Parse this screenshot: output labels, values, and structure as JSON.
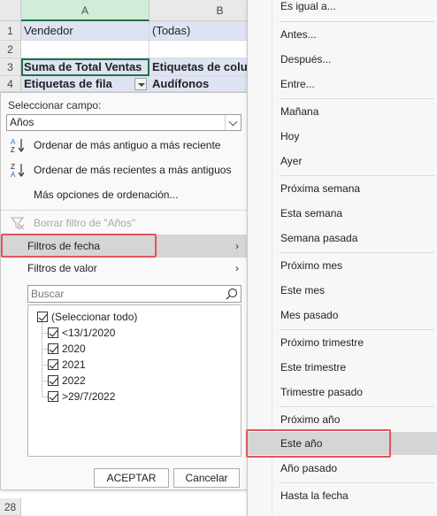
{
  "sheet": {
    "col_a": "A",
    "col_b": "B",
    "rows": [
      {
        "n": "1",
        "a": "Vendedor",
        "b": "(Todas)"
      },
      {
        "n": "2",
        "a": "",
        "b": ""
      },
      {
        "n": "3",
        "a": "Suma de Total Ventas",
        "b": "Etiquetas de colu"
      },
      {
        "n": "4",
        "a": "Etiquetas de fila",
        "b": "Audífonos"
      }
    ],
    "bottom_row": "28"
  },
  "panel": {
    "field_label": "Seleccionar campo:",
    "field_value": "Años",
    "sort_asc": "Ordenar de más antiguo a más reciente",
    "sort_desc": "Ordenar de más recientes a más antiguos",
    "more_sort": "Más opciones de ordenación...",
    "clear_filter": "Borrar filtro de \"Años\"",
    "date_filters": "Filtros de fecha",
    "value_filters": "Filtros de valor",
    "search_placeholder": "Buscar",
    "items": [
      "(Seleccionar todo)",
      "<13/1/2020",
      "2020",
      "2021",
      "2022",
      ">29/7/2022"
    ],
    "ok": "ACEPTAR",
    "cancel": "Cancelar"
  },
  "menu": {
    "items": [
      "Es igual a...",
      "Antes...",
      "Después...",
      "Entre...",
      "Mañana",
      "Hoy",
      "Ayer",
      "Próxima semana",
      "Esta semana",
      "Semana pasada",
      "Próximo mes",
      "Este mes",
      "Mes pasado",
      "Próximo trimestre",
      "Este trimestre",
      "Trimestre pasado",
      "Próximo año",
      "Este año",
      "Año pasado",
      "Hasta la fecha"
    ]
  },
  "colors": {
    "accent_green": "#217346",
    "highlight_red": "#e0555b",
    "pivot_blue": "#dde3f2"
  }
}
